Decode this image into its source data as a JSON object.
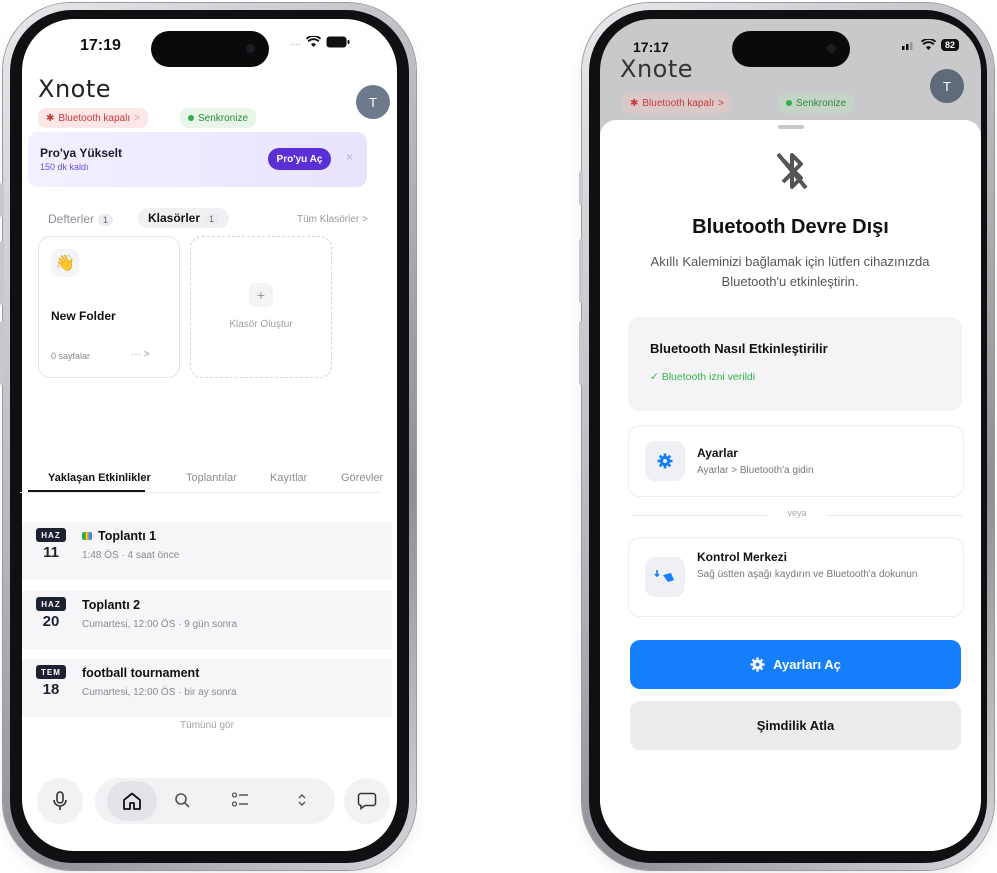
{
  "left_phone": {
    "time": "17:19",
    "status": {
      "signal": "....",
      "wifi": "wifi-icon",
      "battery": "battery-icon"
    },
    "logo": "Xnote",
    "avatar_initial": "T",
    "chips": {
      "bluetooth": "Bluetooth kapalı",
      "bluetooth_arrow": ">",
      "sync": "Senkronize"
    },
    "promo": {
      "title": "Pro'ya Yükselt",
      "subtitle": "150 dk kaldı",
      "button": "Pro'yu Aç",
      "close": "×"
    },
    "tabs": [
      {
        "label": "Defterler",
        "count": "1"
      },
      {
        "label": "Klasörler",
        "count": "1"
      }
    ],
    "all_folders_link": "Tüm Klasörler >",
    "folder": {
      "emoji": "👋",
      "name": "New Folder",
      "pages": "0 sayfalar",
      "more": "··· >"
    },
    "create_folder": {
      "plus": "+",
      "label": "Klasör Oluştur"
    },
    "event_tabs": [
      "Yaklaşan Etkinlikler",
      "Toplantılar",
      "Kayıtlar",
      "Görevler"
    ],
    "events": [
      {
        "month": "HAZ",
        "day": "11",
        "title": "Toplantı 1",
        "subtitle": "1:48 ÖS · 4 saat önce"
      },
      {
        "month": "HAZ",
        "day": "20",
        "title": "Toplantı 2",
        "subtitle": "Cumartesi, 12:00 ÖS · 9 gün sonra"
      },
      {
        "month": "TEM",
        "day": "18",
        "title": "football tournament",
        "subtitle": "Cumartesi, 12:00 ÖS · bir ay sonra"
      }
    ],
    "see_all": "Tümünü gör",
    "dock": {
      "mic": "microphone-icon",
      "home": "home-icon",
      "search": "search-icon",
      "tasks": "task-list-icon",
      "sort": "sort-icon",
      "chat": "chat-icon"
    }
  },
  "right_phone": {
    "time": "17:17",
    "battery": "82",
    "logo": "Xnote",
    "avatar_initial": "T",
    "chips": {
      "bluetooth": "Bluetooth kapalı",
      "bluetooth_arrow": ">",
      "sync": "Senkronize"
    },
    "sheet": {
      "title": "Bluetooth Devre Dışı",
      "description": "Akıllı Kaleminizi bağlamak için lütfen cihazınızda Bluetooth'u etkinleştirin.",
      "howto_title": "Bluetooth Nasıl Etkinleştirilir",
      "permission": "✓ Bluetooth izni verildi",
      "settings_title": "Ayarlar",
      "settings_sub": "Ayarlar > Bluetooth'a gidin",
      "or": "veya",
      "control_title": "Kontrol Merkezi",
      "control_sub": "Sağ üstten aşağı kaydırın ve Bluetooth'a dokunun",
      "primary_button": "Ayarları Aç",
      "secondary_button": "Şimdilik Atla"
    }
  },
  "colors": {
    "accent_purple": "#5a2fd6",
    "primary_blue": "#147efb",
    "success_green": "#34b44a",
    "error_red": "#c83a3a"
  }
}
